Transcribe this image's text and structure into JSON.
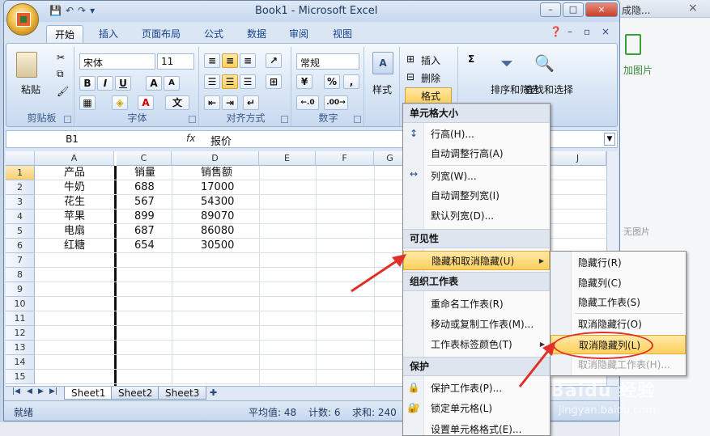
{
  "window": {
    "title": "Book1 - Microsoft Excel",
    "controls": [
      "–",
      "□",
      "×"
    ],
    "qat": [
      "💾",
      "↶",
      "↷",
      "▾"
    ]
  },
  "background": {
    "tab_title": "成隐...",
    "add_image": "加图片",
    "no_image": "无图片",
    "watermark": "Baidu 经验",
    "watermark_url": "jingyan.baidu.com"
  },
  "tabs": [
    "开始",
    "插入",
    "页面布局",
    "公式",
    "数据",
    "审阅",
    "视图"
  ],
  "ribbon": {
    "clipboard": {
      "label": "剪贴板",
      "paste": "粘贴"
    },
    "font": {
      "label": "字体",
      "name": "宋体",
      "size": "11",
      "bold": "B",
      "italic": "I",
      "underline": "U",
      "grow": "A",
      "shrink": "A",
      "wen": "文"
    },
    "align": {
      "label": "对齐方式"
    },
    "number": {
      "label": "数字",
      "format": "常规",
      "percent": "%",
      "comma": ",",
      "inc": "←.0",
      "dec": ".00→"
    },
    "style": {
      "label": "样式"
    },
    "cells": {
      "insert": "插入",
      "delete": "删除",
      "format": "格式"
    },
    "edit": {
      "sort": "排序和筛选",
      "find": "查找和选择",
      "sigma": "Σ"
    }
  },
  "formula_bar": {
    "name_box": "B1",
    "fx": "fx",
    "value": "报价"
  },
  "columns": [
    "A",
    "C",
    "D",
    "E",
    "F",
    "G",
    "J"
  ],
  "rows": [
    "1",
    "2",
    "3",
    "4",
    "5",
    "6",
    "7",
    "8",
    "9",
    "10",
    "11",
    "12",
    "13",
    "14",
    "15"
  ],
  "cells": [
    [
      "产品",
      "销量",
      "销售额"
    ],
    [
      "牛奶",
      "688",
      "17000"
    ],
    [
      "花生",
      "567",
      "54300"
    ],
    [
      "苹果",
      "899",
      "89070"
    ],
    [
      "电扇",
      "687",
      "86080"
    ],
    [
      "红糖",
      "654",
      "30500"
    ]
  ],
  "sheets": [
    "Sheet1",
    "Sheet2",
    "Sheet3"
  ],
  "status": {
    "ready": "就绪",
    "average": "平均值: 48",
    "count": "计数: 6",
    "sum": "求和: 240"
  },
  "menu": {
    "size_header": "单元格大小",
    "row_height": "行高(H)...",
    "autofit_row": "自动调整行高(A)",
    "col_width": "列宽(W)...",
    "autofit_col": "自动调整列宽(I)",
    "default_width": "默认列宽(D)...",
    "visibility_header": "可见性",
    "hide_unhide": "隐藏和取消隐藏(U)",
    "organize_header": "组织工作表",
    "rename": "重命名工作表(R)",
    "move_copy": "移动或复制工作表(M)...",
    "tab_color": "工作表标签颜色(T)",
    "protect_header": "保护",
    "protect_sheet": "保护工作表(P)...",
    "lock_cell": "锁定单元格(L)",
    "format_cells": "设置单元格格式(E)..."
  },
  "submenu": {
    "hide_rows": "隐藏行(R)",
    "hide_cols": "隐藏列(C)",
    "hide_sheet": "隐藏工作表(S)",
    "unhide_rows": "取消隐藏行(O)",
    "unhide_cols": "取消隐藏列(L)",
    "unhide_sheet": "取消隐藏工作表(H)..."
  },
  "colors": {
    "highlight": "#ffcf5c",
    "annotation": "#e0302a"
  }
}
